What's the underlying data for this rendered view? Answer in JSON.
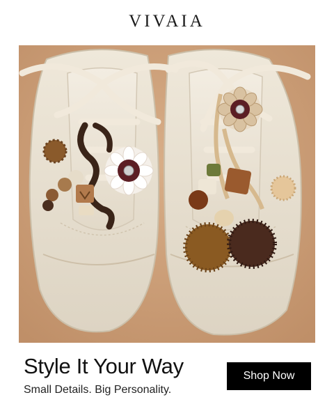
{
  "brand": {
    "logo_text": "VIVAIA"
  },
  "hero": {
    "alt": "Product photo"
  },
  "promo": {
    "headline": "Style It Your Way",
    "subheadline": "Small Details. Big Personality.",
    "cta_label": "Shop Now"
  },
  "colors": {
    "background": "#ffffff",
    "photo_backdrop": "#cfa27c",
    "shoe_suede": "#e8e0d0",
    "cta_background": "#000000",
    "cta_text": "#ffffff"
  }
}
